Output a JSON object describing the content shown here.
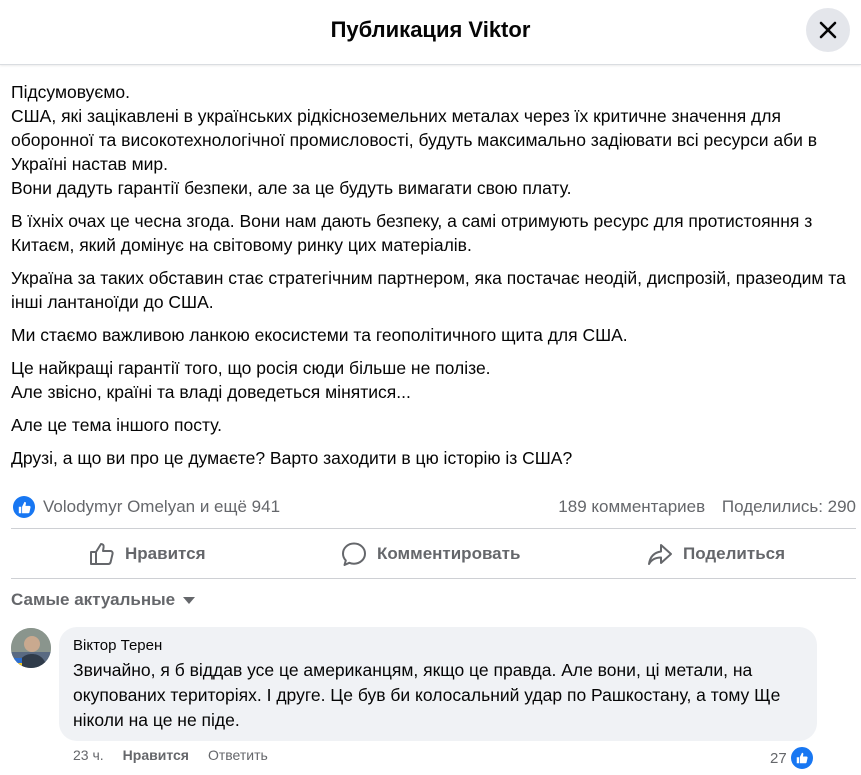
{
  "header": {
    "title": "Публикация Viktor"
  },
  "post": {
    "paragraphs": [
      "Підсумовуємо.\nСША, які зацікавлені в українських рідкісноземельних металах через їх критичне значення для оборонної та високотехнологічної промисловості, будуть максимально задіювати всі ресурси аби в Україні настав мир.\nВони дадуть гарантії безпеки, але за це будуть вимагати свою плату.",
      "В їхніх очах це чесна згода. Вони нам дають безпеку, а самі отримують ресурс для протистояння з Китаєм, який домінує на світовому ринку цих матеріалів.",
      "Україна за таких обставин стає стратегічним партнером, яка постачає неодій, диспрозій, празеодим та інші лантаноїди до США.",
      "Ми стаємо важливою ланкою екосистеми та геополітичного щита для США.",
      "Це найкращі гарантії того, що росія сюди більше не полізе.\nАле звісно, країні та владі доведеться мінятися...",
      "Але це тема іншого посту.",
      "Друзі, а що ви про це думаєте? Варто заходити в цю історію із США?"
    ]
  },
  "stats": {
    "likes": "Volodymyr Omelyan и ещё 941",
    "comments": "189 комментариев",
    "shares": "Поделились: 290"
  },
  "actions": {
    "like": "Нравится",
    "comment": "Комментировать",
    "share": "Поделиться"
  },
  "sort": {
    "label": "Самые актуальные"
  },
  "comment": {
    "author": "Віктор Терен",
    "text": "Звичайно, я б віддав усе це американцям, якщо це правда. Але вони, ці метали, на окупованих територіях. І друге. Це був би колосальний удар по Рашкостану, а тому Ще ніколи на це не піде.",
    "time": "23 ч.",
    "like": "Нравится",
    "reply": "Ответить",
    "reactions": "27"
  },
  "colors": {
    "accent": "#1877f2",
    "secondary_text": "#65676b",
    "bubble": "#f0f2f5"
  },
  "icons": [
    "close-icon",
    "like-badge-icon",
    "thumbs-up-icon",
    "comment-icon",
    "share-icon",
    "caret-down-icon"
  ]
}
